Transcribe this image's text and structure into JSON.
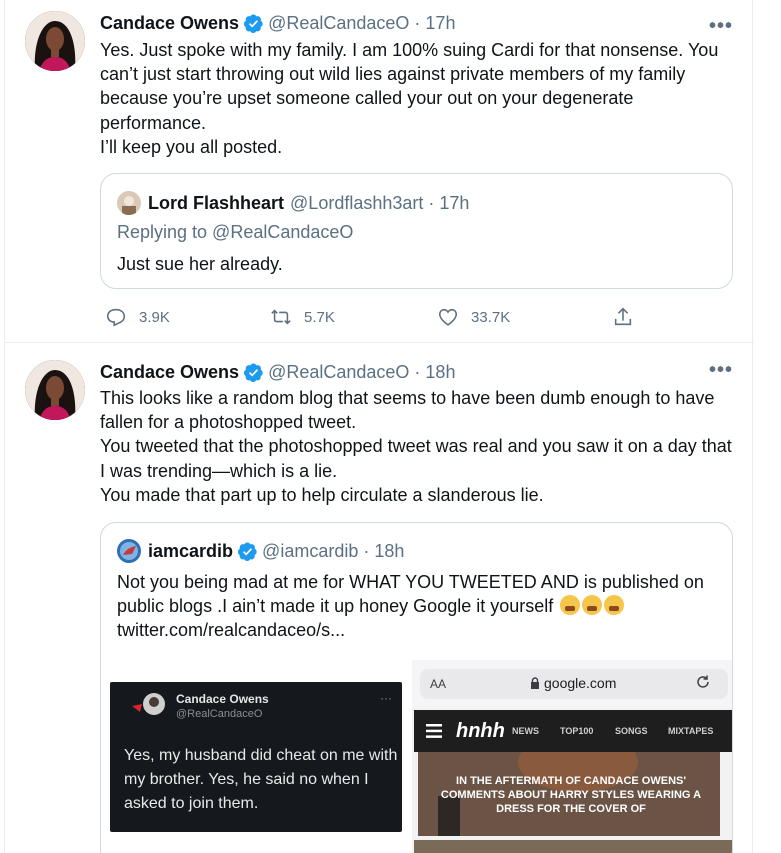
{
  "tweets": [
    {
      "author_name": "Candace Owens",
      "handle": "@RealCandaceO",
      "separator": "·",
      "time": "17h",
      "more_label": "•••",
      "lines": [
        "Yes. Just spoke with my family. I am 100% suing Cardi for that nonsense. You can’t just start throwing out wild lies against private members of my family because you’re upset someone called your out on your degenerate performance.",
        "I’ll keep you all posted."
      ],
      "quote": {
        "author_name": "Lord Flashheart",
        "handle": "@Lordflashh3art",
        "separator": "·",
        "time": "17h",
        "replying_to": "Replying to @RealCandaceO",
        "text": "Just sue her already."
      },
      "actions": {
        "replies": "3.9K",
        "retweets": "5.7K",
        "likes": "33.7K"
      }
    },
    {
      "author_name": "Candace Owens",
      "handle": "@RealCandaceO",
      "separator": "·",
      "time": "18h",
      "more_label": "•••",
      "lines": [
        "This looks like a random blog that seems to have been dumb enough to have fallen for a photoshopped tweet.",
        "You tweeted that the photoshopped tweet was real and you saw it on a day that I was trending—which is a lie.",
        "You made that part up to help circulate a slanderous lie."
      ],
      "quote": {
        "author_name": "iamcardib",
        "handle": "@iamcardib",
        "separator": "·",
        "time": "18h",
        "text": "Not you being mad at me for WHAT YOU TWEETED AND is published on public blogs .I ain’t made it up honey Google it yourself",
        "link": "twitter.com/realcandaceo/s...",
        "media_left": {
          "name": "Candace Owens",
          "handle": "@RealCandaceO",
          "text": "Yes, my husband did cheat on me with my brother. Yes, he said no when I asked to join them."
        },
        "media_right": {
          "aa": "AA",
          "url": "google.com",
          "logo": "hnhh",
          "nav": [
            "NEWS",
            "TOP100",
            "SONGS",
            "MIXTAPES"
          ],
          "headline": "IN THE AFTERMATH OF CANDACE OWENS' COMMENTS ABOUT HARRY STYLES WEARING A DRESS FOR THE COVER OF"
        }
      }
    }
  ],
  "icons": [
    "verified-badge-icon",
    "more-icon",
    "reply-icon",
    "retweet-icon",
    "like-icon",
    "share-icon",
    "lock-icon",
    "reload-icon",
    "hamburger-menu-icon",
    "weary-face-emoji"
  ],
  "colors": {
    "text": "#0f1419",
    "secondary": "#5b7083",
    "verified": "#1d9bf0",
    "border": "#cfd9de",
    "divider": "#ebeef0"
  }
}
